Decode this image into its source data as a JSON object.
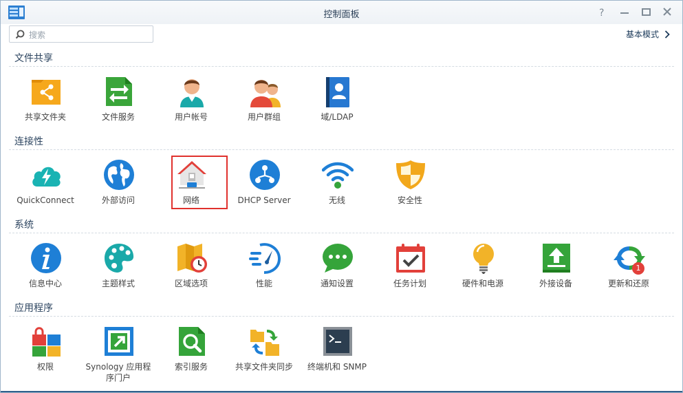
{
  "window": {
    "title": "控制面板"
  },
  "search": {
    "placeholder": "搜索"
  },
  "header": {
    "mode_label": "基本模式"
  },
  "sections": {
    "file_sharing": {
      "title": "文件共享"
    },
    "connectivity": {
      "title": "连接性"
    },
    "system": {
      "title": "系统"
    },
    "applications": {
      "title": "应用程序"
    }
  },
  "items": {
    "shared_folder": {
      "label": "共享文件夹",
      "icon": "shared-folder-icon"
    },
    "file_services": {
      "label": "文件服务",
      "icon": "file-services-icon"
    },
    "user_account": {
      "label": "用户帐号",
      "icon": "user-icon"
    },
    "user_group": {
      "label": "用户群组",
      "icon": "user-group-icon"
    },
    "domain_ldap": {
      "label": "域/LDAP",
      "icon": "domain-ldap-icon"
    },
    "quickconnect": {
      "label": "QuickConnect",
      "icon": "quickconnect-icon"
    },
    "external_access": {
      "label": "外部访问",
      "icon": "globe-icon"
    },
    "network": {
      "label": "网络",
      "icon": "network-house-icon"
    },
    "dhcp_server": {
      "label": "DHCP Server",
      "icon": "dhcp-icon"
    },
    "wireless": {
      "label": "无线",
      "icon": "wifi-icon"
    },
    "security": {
      "label": "安全性",
      "icon": "shield-icon"
    },
    "info_center": {
      "label": "信息中心",
      "icon": "info-icon"
    },
    "theme": {
      "label": "主题样式",
      "icon": "palette-icon"
    },
    "regional": {
      "label": "区域选项",
      "icon": "map-clock-icon"
    },
    "performance": {
      "label": "性能",
      "icon": "speedometer-icon"
    },
    "notification": {
      "label": "通知设置",
      "icon": "chat-bubble-icon"
    },
    "task_scheduler": {
      "label": "任务计划",
      "icon": "calendar-check-icon"
    },
    "hardware_power": {
      "label": "硬件和电源",
      "icon": "lightbulb-icon"
    },
    "external_devices": {
      "label": "外接设备",
      "icon": "upload-icon"
    },
    "update_restore": {
      "label": "更新和还原",
      "icon": "refresh-icon",
      "badge": "1"
    },
    "privileges": {
      "label": "权限",
      "icon": "lock-grid-icon"
    },
    "app_portal": {
      "label_line1": "Synology 应用程",
      "label_line2": "序门户",
      "icon": "portal-icon"
    },
    "indexing": {
      "label": "索引服务",
      "icon": "magnifier-icon"
    },
    "folder_sync": {
      "label": "共享文件夹同步",
      "icon": "folder-sync-icon"
    },
    "terminal_snmp": {
      "label": "终端机和 SNMP",
      "icon": "terminal-icon"
    }
  },
  "colors": {
    "selection_border": "#e0312d",
    "title_text": "#2a3f57",
    "accent_blue": "#1e88e5"
  }
}
